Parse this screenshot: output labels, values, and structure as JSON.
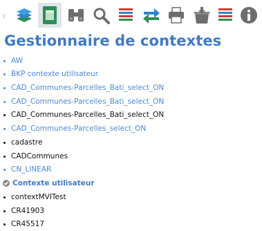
{
  "toolbar": {
    "colors": {
      "blue": "#2e86c9",
      "green": "#2d8f53",
      "red": "#d9392f",
      "gray": "#6d6d6d"
    },
    "buttons": [
      {
        "icon": "layers-icon"
      },
      {
        "icon": "context-manager-icon",
        "active": true
      },
      {
        "icon": "binoculars-icon"
      },
      {
        "icon": "search-icon"
      },
      {
        "icon": "legend-list-icon"
      },
      {
        "icon": "swap-arrows-icon"
      },
      {
        "icon": "printer-icon"
      },
      {
        "icon": "download-box-icon"
      },
      {
        "icon": "legend-list-icon-2"
      },
      {
        "icon": "info-icon"
      }
    ]
  },
  "page": {
    "title": "Gestionnaire de contextes"
  },
  "contexts": [
    {
      "label": "AW",
      "style": "link"
    },
    {
      "label": "BKP contexte utilisateur",
      "style": "link"
    },
    {
      "label": "CAD_Communes-Parcelles_Bati_select_ON",
      "style": "link"
    },
    {
      "label": "CAD_Communes-Parcelles_Bati_select_ON",
      "style": "link"
    },
    {
      "label": "CAD_Communes-Parcelles_Bati_select_ON",
      "style": "plain"
    },
    {
      "label": "CAD_Communes-Parcelles_select_ON",
      "style": "link"
    },
    {
      "label": "cadastre",
      "style": "plain"
    },
    {
      "label": "CADCommunes",
      "style": "plain"
    },
    {
      "label": "CN_LINEAR",
      "style": "link"
    },
    {
      "label": "Contexte utilisateur",
      "style": "active"
    },
    {
      "label": "contextMVITest",
      "style": "plain"
    },
    {
      "label": "CR41903",
      "style": "plain"
    },
    {
      "label": "CR45517",
      "style": "plain"
    }
  ]
}
